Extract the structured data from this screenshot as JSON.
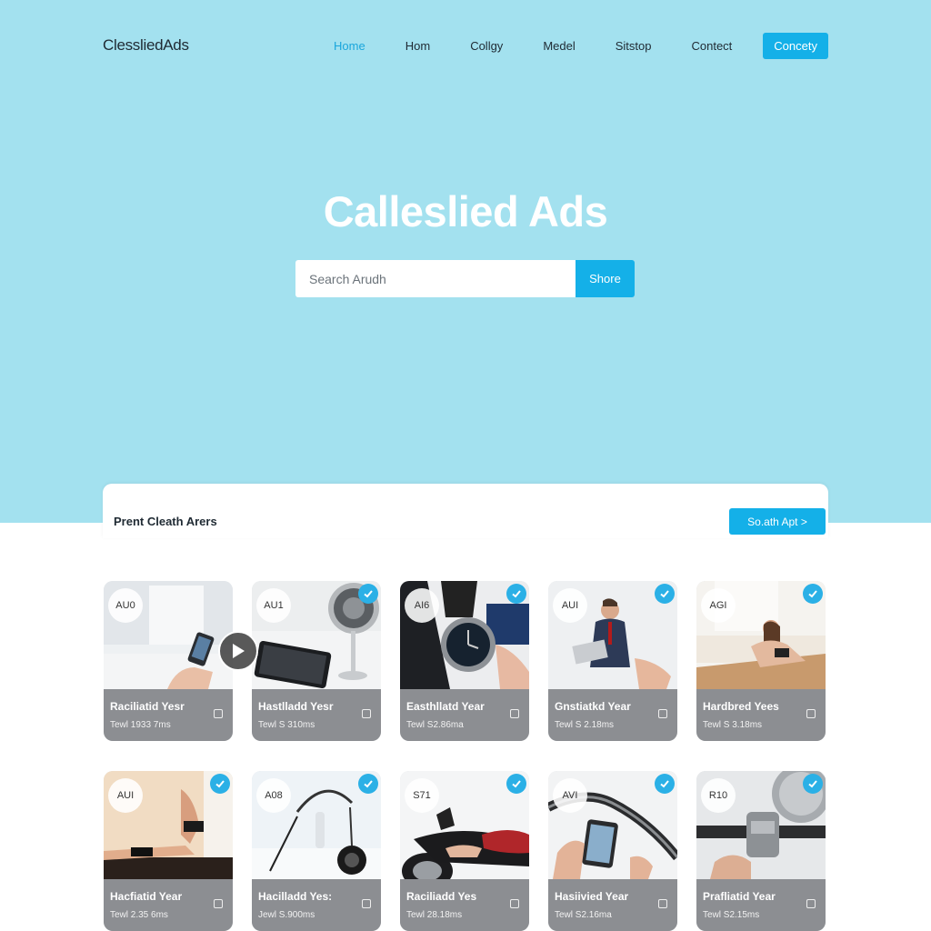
{
  "header": {
    "logo": "ClessliedAds",
    "nav": [
      "Hom",
      "Collgy",
      "Medel",
      "Sitstop",
      "Contect"
    ],
    "active": "Home",
    "cta": "Concety"
  },
  "hero": {
    "title": "Calleslied Ads",
    "search_placeholder": "Search Arudh",
    "search_button": "Shore"
  },
  "section": {
    "title": "Prent Cleath Arers",
    "button": "So.ath Apt >"
  },
  "colors": {
    "hero_bg": "#a3e1ef",
    "accent": "#14b0e8",
    "card_caption_bg": "#8c8e92"
  },
  "cards": [
    {
      "badge": "AU0",
      "title": "Raciliatid Yesr",
      "sub": "Tewl 1933 7ms",
      "verified": false,
      "image": "phone-in-hand"
    },
    {
      "badge": "AU1",
      "title": "Hastlladd Yesr",
      "sub": "Tewl S 310ms",
      "verified": true,
      "image": "tablet-and-lamp"
    },
    {
      "badge": "AI6",
      "title": "Easthllatd Year",
      "sub": "Tewl S2.86ma",
      "verified": true,
      "image": "wristwatch"
    },
    {
      "badge": "AUI",
      "title": "Gnstiatkd Year",
      "sub": "Tewl S 2.18ms",
      "verified": true,
      "image": "man-with-laptop"
    },
    {
      "badge": "AGI",
      "title": "Hardbred Yees",
      "sub": "Tewl S 3.18ms",
      "verified": true,
      "image": "person-on-floor"
    },
    {
      "badge": "AUI",
      "title": "Hacfiatid Year",
      "sub": "Tewl 2.35 6ms",
      "verified": true,
      "image": "legs-stretching"
    },
    {
      "badge": "A08",
      "title": "Hacilladd Yes:",
      "sub": "Jewl S.900ms",
      "verified": true,
      "image": "headphones"
    },
    {
      "badge": "S71",
      "title": "Raciliadd Yes",
      "sub": "Tewl 28.18ms",
      "verified": true,
      "image": "motorcycle"
    },
    {
      "badge": "AVI",
      "title": "Hasiivied Year",
      "sub": "Tewl S2.16ma",
      "verified": true,
      "image": "bike-phone-mount"
    },
    {
      "badge": "R10",
      "title": "Prafliatid Year",
      "sub": "Tewl S2.15ms",
      "verified": true,
      "image": "handlebar"
    }
  ]
}
